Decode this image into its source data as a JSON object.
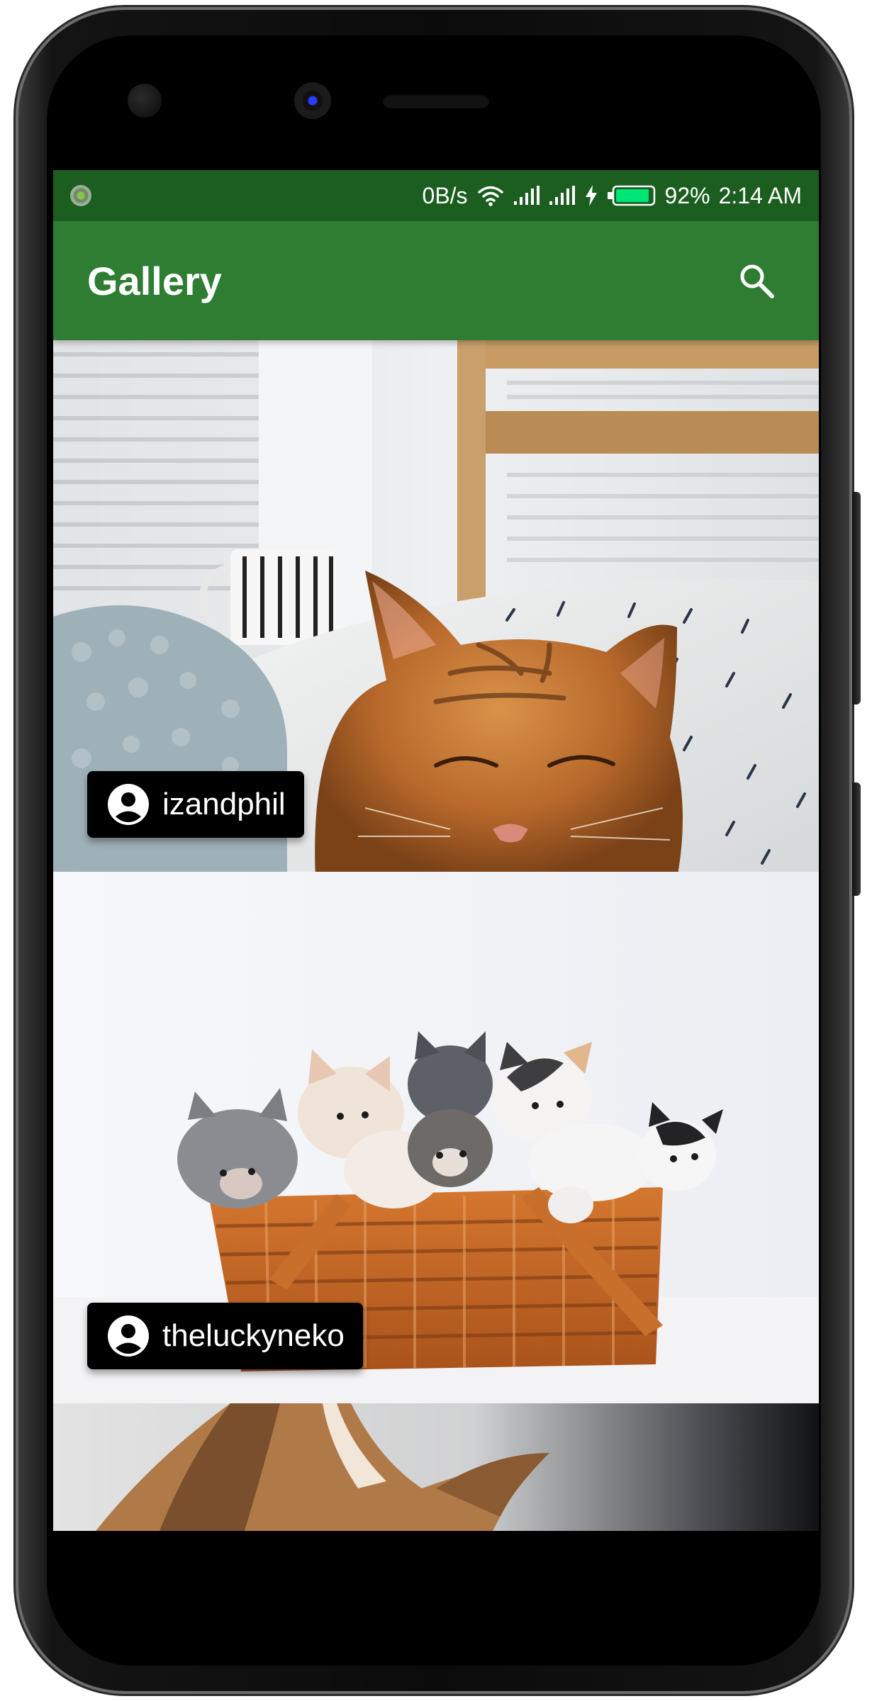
{
  "status_bar": {
    "network_speed": "0B/s",
    "battery_percent": "92%",
    "time": "2:14 AM",
    "battery_level": 0.92,
    "background_color": "#1b5e20",
    "icons": [
      "notification-icon",
      "wifi-icon",
      "signal-icon",
      "signal-icon",
      "charging-icon",
      "battery-icon"
    ]
  },
  "app_bar": {
    "title": "Gallery",
    "background_color": "#2e7d32",
    "action_icon": "search-icon"
  },
  "gallery": {
    "items": [
      {
        "author": "izandphil",
        "avatar_icon": "account-circle-icon",
        "image": "sleeping-orange-tabby-cat"
      },
      {
        "author": "theluckyneko",
        "avatar_icon": "account-circle-icon",
        "image": "kittens-in-wicker-basket"
      },
      {
        "author": "",
        "avatar_icon": "",
        "image": "cat-close-up-partial"
      }
    ]
  }
}
